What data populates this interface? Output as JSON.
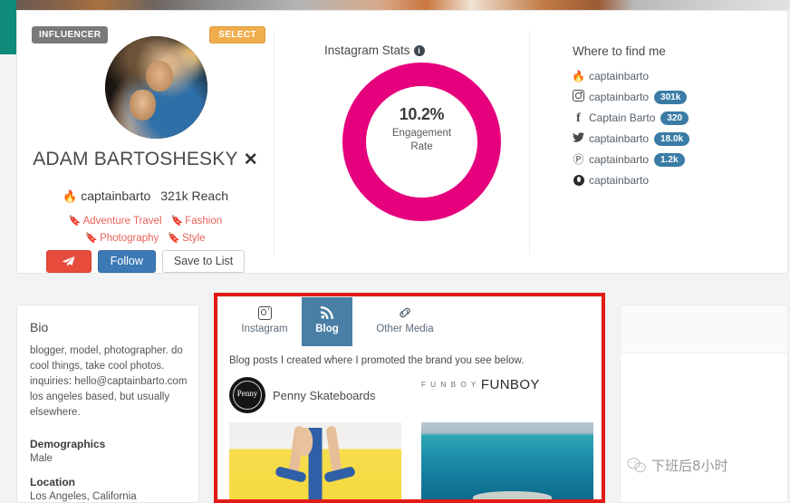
{
  "profile": {
    "badge_influencer": "INFLUENCER",
    "badge_select": "SELECT",
    "name": "ADAM BARTOSHESKY",
    "close_mark": "✕",
    "flame_icon": "🔥",
    "handle": "captainbarto",
    "reach": "321k Reach",
    "tags": [
      {
        "label": "Adventure Travel"
      },
      {
        "label": "Fashion"
      },
      {
        "label": "Photography"
      },
      {
        "label": "Style"
      }
    ],
    "buttons": {
      "send_icon": "paper-plane-icon",
      "follow": "Follow",
      "save": "Save to List"
    }
  },
  "stats": {
    "title": "Instagram Stats",
    "info_icon": "i",
    "chart_data": {
      "type": "pie",
      "title": "Instagram Stats",
      "categories": [
        "Engagement Rate"
      ],
      "values": [
        10.2
      ],
      "center_value": "10.2%",
      "center_label_line1": "Engagement",
      "center_label_line2": "Rate",
      "color": "#e6007e",
      "legend": "none"
    }
  },
  "find": {
    "title": "Where to find me",
    "rows": [
      {
        "icon": "flame-icon",
        "glyph": "🔥",
        "handle": "captainbarto",
        "count": ""
      },
      {
        "icon": "instagram-icon",
        "glyph": "",
        "handle": "captainbarto",
        "count": "301k"
      },
      {
        "icon": "facebook-icon",
        "glyph": "f",
        "handle": "Captain Barto",
        "count": "320"
      },
      {
        "icon": "twitter-icon",
        "glyph": "🐦",
        "handle": "captainbarto",
        "count": "18.0k"
      },
      {
        "icon": "pinterest-icon",
        "glyph": "Ⓟ",
        "handle": "captainbarto",
        "count": "1.2k"
      },
      {
        "icon": "snapchat-icon",
        "glyph": "",
        "handle": "captainbarto",
        "count": ""
      }
    ]
  },
  "bio": {
    "heading": "Bio",
    "text": "blogger, model, photographer. do cool things, take cool photos. inquiries: hello@captainbarto.com los angeles based, but usually elsewhere.",
    "demographics_label": "Demographics",
    "demographics_value": "Male",
    "location_label": "Location",
    "location_value": "Los Angeles, California"
  },
  "media": {
    "tabs": [
      {
        "label": "Instagram",
        "icon": "instagram-icon",
        "active": false
      },
      {
        "label": "Blog",
        "icon": "rss-icon",
        "active": true
      },
      {
        "label": "Other Media",
        "icon": "link-icon",
        "active": false
      }
    ],
    "description": "Blog posts I created where I promoted the brand you see below.",
    "cards": [
      {
        "logo": "penny-logo",
        "logo_text": "Penny",
        "title": "Penny Skateboards"
      },
      {
        "logo": "funboy-logo",
        "logo_text": "F U N B O Y",
        "title": "FUNBOY"
      }
    ]
  },
  "watermark": {
    "text": "下班后8小时"
  }
}
